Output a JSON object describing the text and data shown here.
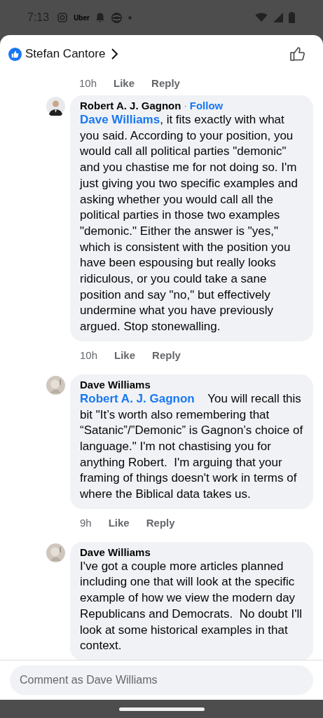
{
  "status_bar": {
    "time": "7:13",
    "notification_text": "Uber"
  },
  "header": {
    "title": "Stefan Cantore"
  },
  "top_actions": {
    "time": "10h",
    "like": "Like",
    "reply": "Reply"
  },
  "comments": [
    {
      "author": "Robert A. J. Gagnon",
      "avatar": {
        "kind": "suit"
      },
      "separator": "·",
      "follow": "Follow",
      "mention": "Dave Williams",
      "text": ", it fits exactly with what you said. According to your position, you would call all political parties \"demonic\" and you chastise me for not doing so. I'm just giving you two specific examples and asking whether you would call all the political parties in those two examples \"demonic.\" Either the answer is \"yes,\" which is consistent with the position you have been espousing but really looks ridiculous, or you could take a sane position and say \"no,\" but effectively undermine what you have previously argued. Stop stonewalling.",
      "time": "10h",
      "like": "Like",
      "reply": "Reply"
    },
    {
      "author": "Dave Williams",
      "avatar": {
        "kind": "sketch"
      },
      "mention": "Robert A. J. Gagnon",
      "text": "    You will recall this bit \"It’s worth also remembering that “Satanic”/”Demonic” is Gagnon’s choice of language.\" I'm not chastising you for anything Robert.  I'm arguing that your framing of things doesn't work in terms of where the Biblical data takes us.",
      "time": "9h",
      "like": "Like",
      "reply": "Reply"
    },
    {
      "author": "Dave Williams",
      "avatar": {
        "kind": "sketch"
      },
      "text": "I've got a couple more articles planned including one that will look at the specific example of how we view the modern day Republicans and Democrats.  No doubt I'll look at some historical examples in that context."
    }
  ],
  "composer": {
    "placeholder": "Comment as Dave Williams"
  }
}
